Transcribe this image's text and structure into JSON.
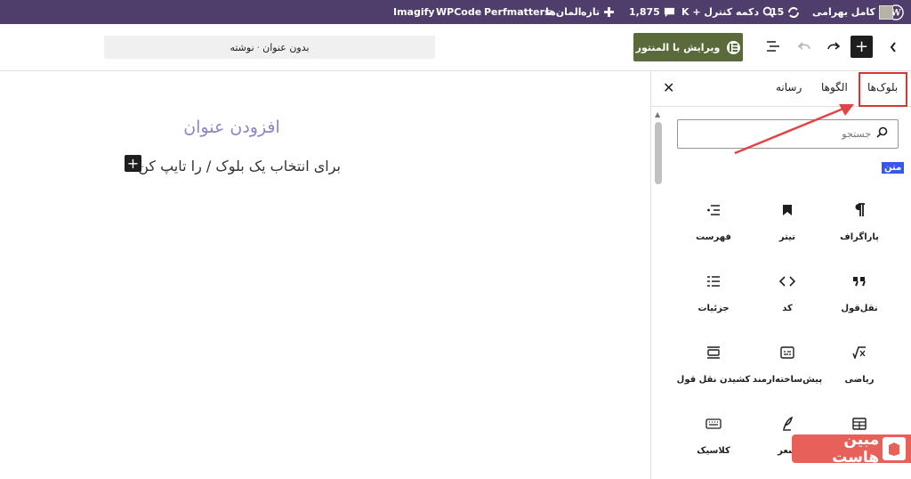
{
  "adminbar": {
    "user": "کامل بهرامی",
    "updates_count": "15",
    "command_palette": "دکمه کنترل + K",
    "comments_count": "1,875",
    "new_label": "تازه",
    "elements_label": "المان‌ها",
    "plugins": [
      "Perfmatters",
      "WPCode",
      "Imagify"
    ]
  },
  "header": {
    "elementor_button": "ویرایش با المنتور",
    "doc_title": "بدون عنوان",
    "doc_type": "نوشته"
  },
  "canvas": {
    "title_placeholder": "افزودن عنوان",
    "block_prompt": "برای انتخاب یک بلوک / را تایپ کن"
  },
  "inserter": {
    "tabs": [
      "بلوک‌ها",
      "الگوها",
      "رسانه"
    ],
    "search_placeholder": "جستجو",
    "category": "متن",
    "blocks": [
      {
        "label": "پاراگراف",
        "icon": "paragraph-icon"
      },
      {
        "label": "تیتر",
        "icon": "heading-icon"
      },
      {
        "label": "فهرست",
        "icon": "list-icon"
      },
      {
        "label": "نقل‌قول",
        "icon": "quote-icon"
      },
      {
        "label": "کد",
        "icon": "code-icon"
      },
      {
        "label": "جزئیات",
        "icon": "details-icon"
      },
      {
        "label": "ریاضی",
        "icon": "math-icon"
      },
      {
        "label": "پیش‌ساخته‌ارمند",
        "icon": "preformatted-icon"
      },
      {
        "label": "کشیدن نقل قول",
        "icon": "pullquote-icon"
      },
      {
        "label": "",
        "icon": "table-icon"
      },
      {
        "label": "شعر",
        "icon": "verse-icon"
      },
      {
        "label": "کلاسیک",
        "icon": "classic-icon"
      }
    ]
  },
  "watermark": {
    "text": "مبین هاست"
  },
  "colors": {
    "adminbar": "#4f3d6b",
    "elementor": "#5b6a3b",
    "accent": "#3858e9",
    "highlight": "#d63638"
  }
}
